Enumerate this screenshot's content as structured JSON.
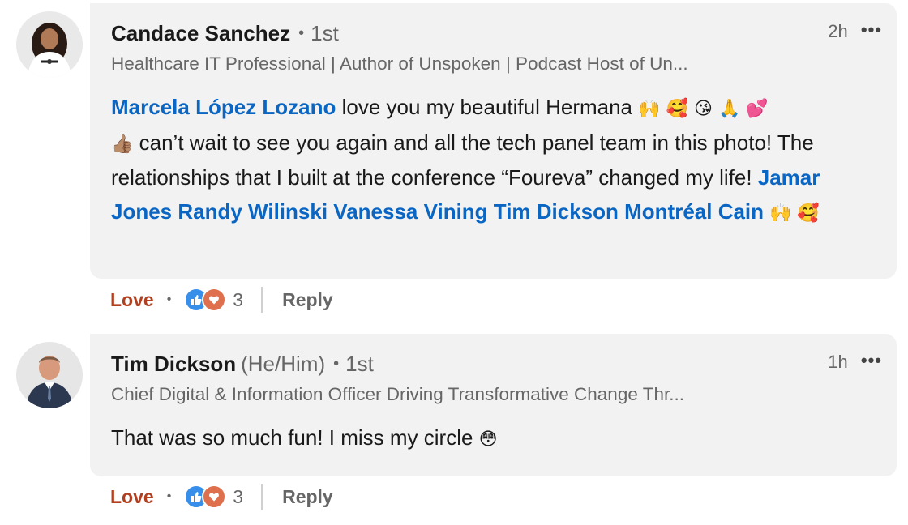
{
  "comments": [
    {
      "author": "Candace Sanchez",
      "pronouns": "",
      "degree": "1st",
      "headline": "Healthcare IT Professional | Author of Unspoken | Podcast Host of Un...",
      "time": "2h",
      "more_label": "•••",
      "mention_1": "Marcela López Lozano",
      "text_1": " love you my beautiful Hermana ",
      "emoji_1": "🙌 🥰 😘 🙏 💕",
      "emoji_2": "👍🏽",
      "text_2": "  can’t wait to see you again and all the tech panel team in this photo! The relationships that I built at the conference “Foureva” changed my life! ",
      "mentions_2": "Jamar Jones Randy Wilinski Vanessa Vining Tim Dickson Montréal Cain",
      "emoji_3": " 🙌 🥰",
      "reaction_label": "Love",
      "reaction_count": "3",
      "reply_label": "Reply"
    },
    {
      "author": "Tim Dickson",
      "pronouns": "(He/Him)",
      "degree": "1st",
      "headline": "Chief Digital & Information Officer Driving Transformative Change Thr...",
      "time": "1h",
      "more_label": "•••",
      "text": "That was so much fun! I miss my circle ",
      "emoji": "😳",
      "reaction_label": "Love",
      "reaction_count": "3",
      "reply_label": "Reply"
    }
  ],
  "colors": {
    "mention": "#0a66c2",
    "love": "#b24020",
    "bubble": "#f2f2f2",
    "like_badge": "#378fe9",
    "heart_badge": "#df704d"
  }
}
